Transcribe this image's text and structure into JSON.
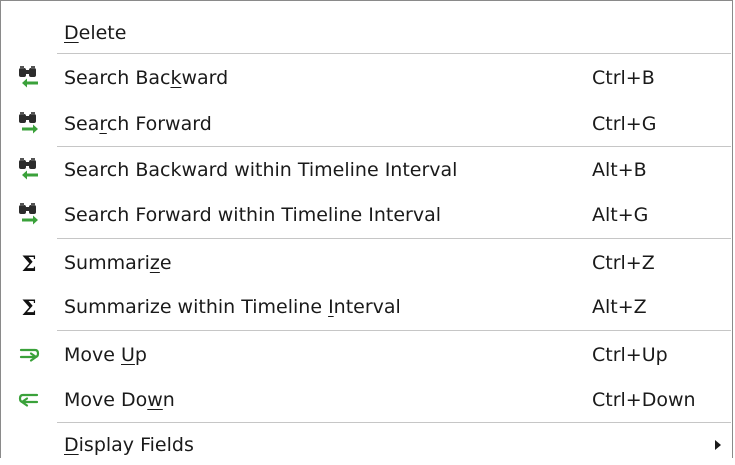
{
  "menu": {
    "delete": {
      "pre": "",
      "mn": "D",
      "post": "elete"
    },
    "search_backward": {
      "pre": "Search Bac",
      "mn": "k",
      "post": "ward",
      "shortcut": "Ctrl+B",
      "icon": "binoculars-back-icon"
    },
    "search_forward": {
      "pre": "Sea",
      "mn": "r",
      "post": "ch Forward",
      "shortcut": "Ctrl+G",
      "icon": "binoculars-forward-icon"
    },
    "search_backward_interval": {
      "pre": "Search Backward within Timeline Interval",
      "mn": "",
      "post": "",
      "shortcut": "Alt+B",
      "icon": "binoculars-back-icon"
    },
    "search_forward_interval": {
      "pre": "Search Forward within Timeline Interval",
      "mn": "",
      "post": "",
      "shortcut": "Alt+G",
      "icon": "binoculars-forward-icon"
    },
    "summarize": {
      "pre": "Summari",
      "mn": "z",
      "post": "e",
      "shortcut": "Ctrl+Z",
      "icon": "sigma-icon",
      "glyph": "Σ"
    },
    "summarize_interval": {
      "pre": "Summarize within Timeline ",
      "mn": "I",
      "post": "nterval",
      "shortcut": "Alt+Z",
      "icon": "sigma-icon",
      "glyph": "Σ"
    },
    "move_up": {
      "pre": "Move ",
      "mn": "U",
      "post": "p",
      "shortcut": "Ctrl+Up",
      "icon": "move-up-icon"
    },
    "move_down": {
      "pre": "Move Do",
      "mn": "w",
      "post": "n",
      "shortcut": "Ctrl+Down",
      "icon": "move-down-icon"
    },
    "display_fields": {
      "pre": "",
      "mn": "D",
      "post": "isplay Fields",
      "icon": "submenu-arrow-icon"
    }
  },
  "colors": {
    "icon_green": "#3aa13a",
    "icon_dark": "#2c2c2c",
    "separator": "#c6c6c6",
    "border": "#8a8a8a"
  }
}
